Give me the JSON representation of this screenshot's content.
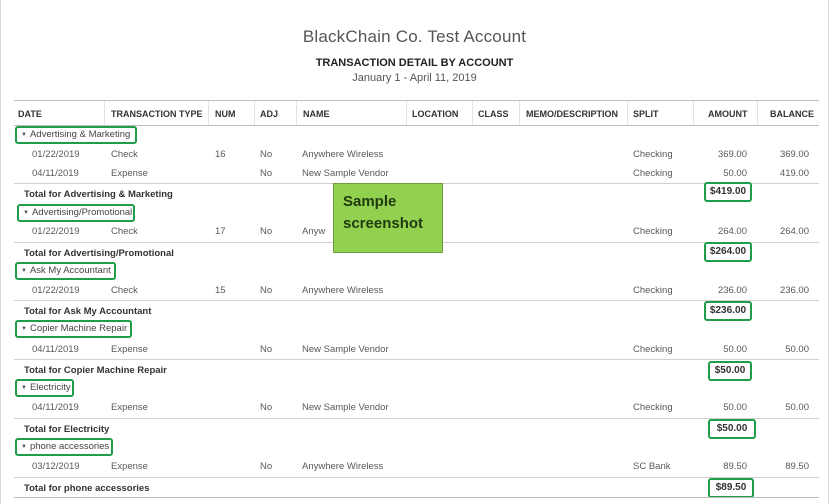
{
  "company": "BlackChain Co. Test Account",
  "report_title": "TRANSACTION DETAIL BY ACCOUNT",
  "date_range": "January 1 - April 11, 2019",
  "columns": [
    "DATE",
    "TRANSACTION TYPE",
    "NUM",
    "ADJ",
    "NAME",
    "LOCATION",
    "CLASS",
    "MEMO/DESCRIPTION",
    "SPLIT",
    "AMOUNT",
    "BALANCE"
  ],
  "groups": [
    {
      "name": "Advertising & Marketing",
      "rows": [
        {
          "date": "01/22/2019",
          "type": "Check",
          "num": "16",
          "adj": "No",
          "name": "Anywhere Wireless",
          "split": "Checking",
          "amount": "369.00",
          "balance": "369.00"
        },
        {
          "date": "04/11/2019",
          "type": "Expense",
          "num": "",
          "adj": "No",
          "name": "New Sample Vendor",
          "split": "Checking",
          "amount": "50.00",
          "balance": "419.00"
        }
      ],
      "total_label": "Total for Advertising & Marketing",
      "total": "$419.00"
    },
    {
      "name": "Advertising/Promotional",
      "rows": [
        {
          "date": "01/22/2019",
          "type": "Check",
          "num": "17",
          "adj": "No",
          "name": "Anyw",
          "split": "Checking",
          "amount": "264.00",
          "balance": "264.00"
        }
      ],
      "total_label": "Total for Advertising/Promotional",
      "total": "$264.00"
    },
    {
      "name": "Ask My Accountant",
      "rows": [
        {
          "date": "01/22/2019",
          "type": "Check",
          "num": "15",
          "adj": "No",
          "name": "Anywhere Wireless",
          "split": "Checking",
          "amount": "236.00",
          "balance": "236.00"
        }
      ],
      "total_label": "Total for Ask My Accountant",
      "total": "$236.00"
    },
    {
      "name": "Copier Machine Repair",
      "rows": [
        {
          "date": "04/11/2019",
          "type": "Expense",
          "num": "",
          "adj": "No",
          "name": "New Sample Vendor",
          "split": "Checking",
          "amount": "50.00",
          "balance": "50.00"
        }
      ],
      "total_label": "Total for Copier Machine Repair",
      "total": "$50.00"
    },
    {
      "name": "Electricity",
      "rows": [
        {
          "date": "04/11/2019",
          "type": "Expense",
          "num": "",
          "adj": "No",
          "name": "New Sample Vendor",
          "split": "Checking",
          "amount": "50.00",
          "balance": "50.00"
        }
      ],
      "total_label": "Total for Electricity",
      "total": "$50.00"
    },
    {
      "name": "phone accessories",
      "rows": [
        {
          "date": "03/12/2019",
          "type": "Expense",
          "num": "",
          "adj": "No",
          "name": "Anywhere Wireless",
          "split": "SC Bank",
          "amount": "89.50",
          "balance": "89.50"
        }
      ],
      "total_label": "Total for phone accessories",
      "total": "$89.50"
    }
  ],
  "sample_overlay": [
    "Sample",
    "screenshot"
  ],
  "colors": {
    "highlight_border": "#1f9e4a",
    "sample_bg": "#92d050"
  }
}
